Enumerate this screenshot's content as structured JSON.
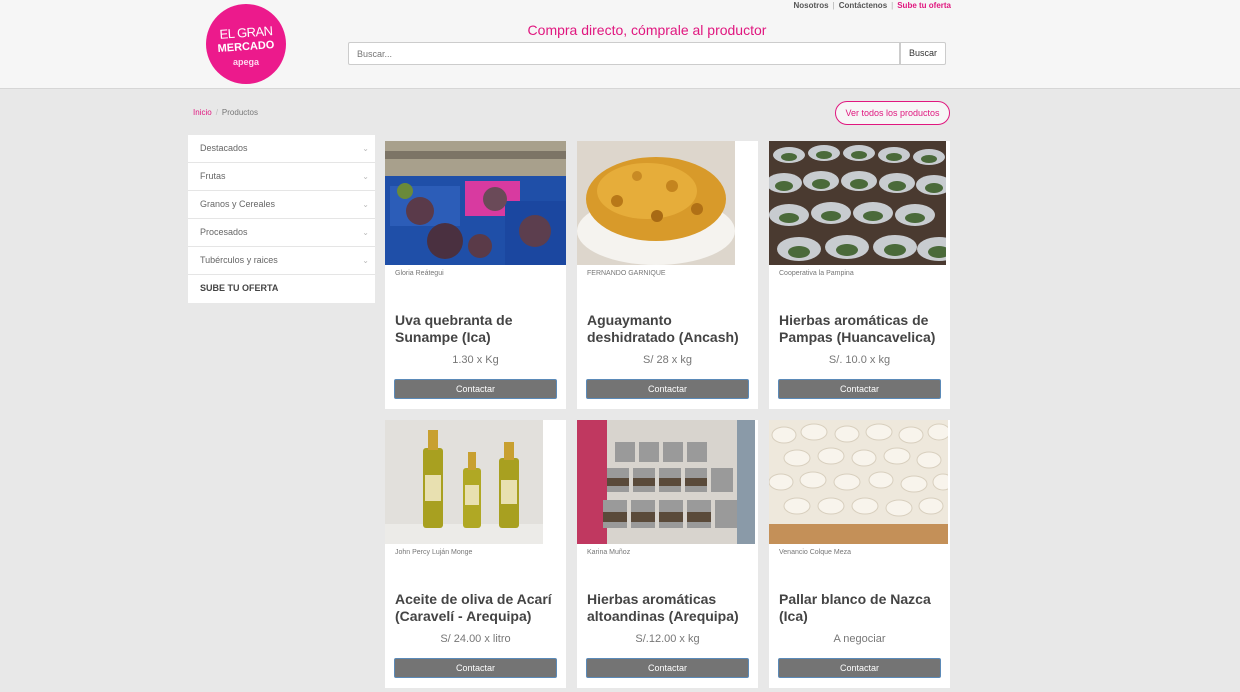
{
  "header": {
    "logo_line1": "EL GRAN",
    "logo_line2": "MERCADO",
    "logo_line3": "apega",
    "nav": [
      "Nosotros",
      "Contáctenos",
      "Sube tu oferta"
    ],
    "tagline": "Compra directo, cómprale al productor",
    "search_placeholder": "Buscar...",
    "search_button": "Buscar"
  },
  "breadcrumb": [
    "Inicio",
    "Productos"
  ],
  "view_all": "Ver todos los productos",
  "sidebar": {
    "items": [
      {
        "label": "Destacados"
      },
      {
        "label": "Frutas"
      },
      {
        "label": "Granos y Cereales"
      },
      {
        "label": "Procesados"
      },
      {
        "label": "Tubérculos y raices"
      }
    ],
    "cta": "SUBE TU OFERTA"
  },
  "products": [
    {
      "seller": "Gloria Reátegui",
      "title": "Uva quebranta de Sunampe (Ica)",
      "price": "1.30 x Kg",
      "button": "Contactar"
    },
    {
      "seller": "FERNANDO GARNIQUE",
      "title": "Aguaymanto deshidratado (Ancash)",
      "price": "S/ 28 x kg",
      "button": "Contactar"
    },
    {
      "seller": "Cooperativa la Pampina",
      "title": "Hierbas aromáticas de Pampas (Huancavelica)",
      "price": "S/. 10.0 x kg",
      "button": "Contactar"
    },
    {
      "seller": "John Percy Luján Monge",
      "title": "Aceite de oliva de Acarí (Caravelí - Arequipa)",
      "price": "S/ 24.00 x litro",
      "button": "Contactar"
    },
    {
      "seller": "Karina Muñoz",
      "title": "Hierbas aromáticas altoandinas (Arequipa)",
      "price": "S/.12.00 x kg",
      "button": "Contactar"
    },
    {
      "seller": "Venancio Colque Meza",
      "title": "Pallar blanco de Nazca (Ica)",
      "price": "A negociar",
      "button": "Contactar"
    }
  ],
  "colors": {
    "brand": "#ec1a8c",
    "button": "#747474",
    "background": "#e8e8e8"
  }
}
